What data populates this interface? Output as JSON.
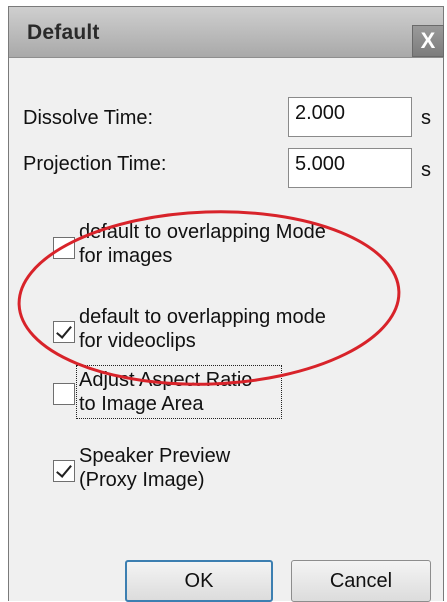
{
  "window": {
    "title": "Default",
    "close_glyph": "X"
  },
  "fields": {
    "dissolve": {
      "label": "Dissolve Time:",
      "value": "2.000",
      "unit": "s"
    },
    "projection": {
      "label": "Projection Time:",
      "value": "5.000",
      "unit": "s"
    }
  },
  "checkboxes": [
    {
      "line1": "default to overlapping Mode",
      "line2": "for images",
      "checked": false
    },
    {
      "line1": "default to overlapping mode",
      "line2": "for videoclips",
      "checked": true
    },
    {
      "line1": "Adjust Aspect Ratio",
      "line2": "to Image Area",
      "checked": false
    },
    {
      "line1": "Speaker Preview",
      "line2": "(Proxy Image)",
      "checked": true
    }
  ],
  "buttons": {
    "ok": "OK",
    "cancel": "Cancel"
  },
  "colors": {
    "annotation_circle": "#d8232a",
    "default_button_border": "#3c7fb1"
  }
}
